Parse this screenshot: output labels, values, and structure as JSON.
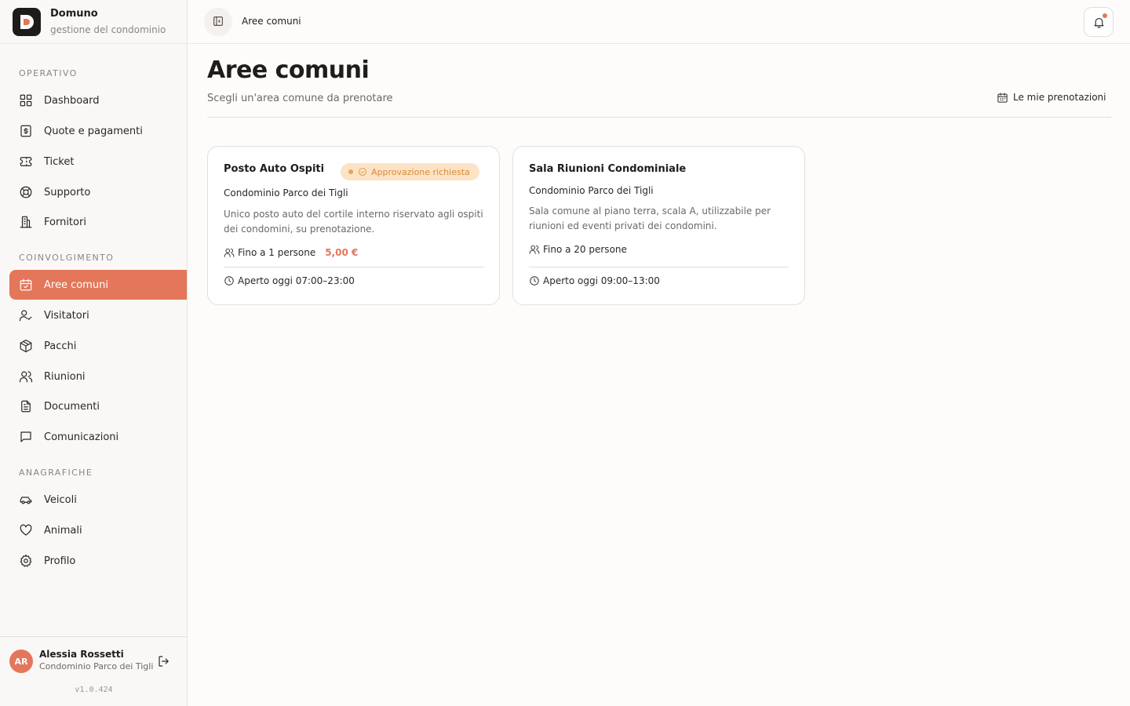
{
  "brand": {
    "name": "Domuno",
    "subtitle": "gestione del condominio"
  },
  "sidebar": {
    "sections": [
      {
        "label": "OPERATIVO"
      },
      {
        "label": "COINVOLGIMENTO"
      },
      {
        "label": "ANAGRAFICHE"
      }
    ],
    "items": [
      {
        "label": "Dashboard",
        "icon": "grid-icon"
      },
      {
        "label": "Quote e pagamenti",
        "icon": "receipt-icon"
      },
      {
        "label": "Ticket",
        "icon": "ticket-icon"
      },
      {
        "label": "Supporto",
        "icon": "lifebuoy-icon"
      },
      {
        "label": "Fornitori",
        "icon": "building-icon"
      },
      {
        "label": "Aree comuni",
        "icon": "calendar-check-icon",
        "active": true
      },
      {
        "label": "Visitatori",
        "icon": "user-check-icon"
      },
      {
        "label": "Pacchi",
        "icon": "package-icon"
      },
      {
        "label": "Riunioni",
        "icon": "users-icon"
      },
      {
        "label": "Documenti",
        "icon": "document-icon"
      },
      {
        "label": "Comunicazioni",
        "icon": "message-icon"
      },
      {
        "label": "Veicoli",
        "icon": "car-icon"
      },
      {
        "label": "Animali",
        "icon": "heart-icon"
      },
      {
        "label": "Profilo",
        "icon": "gear-icon"
      }
    ]
  },
  "user": {
    "initials": "AR",
    "name": "Alessia Rossetti",
    "condominium": "Condominio Parco dei Tigli",
    "version": "v1.0.424"
  },
  "topbar": {
    "breadcrumb": "Aree comuni"
  },
  "page": {
    "title": "Aree comuni",
    "subtitle": "Scegli un'area comune da prenotare",
    "my_bookings": "Le mie prenotazioni"
  },
  "colors": {
    "accent": "#e4765a",
    "badge_bg": "#fde3c5",
    "badge_text": "#d88a38"
  },
  "cards": [
    {
      "title": "Posto Auto Ospiti",
      "badge": "Approvazione richiesta",
      "condominium": "Condominio Parco dei Tigli",
      "description": "Unico posto auto del cortile interno riservato agli ospiti dei condomini, su prenotazione.",
      "capacity": "Fino a 1 persone",
      "price": "5,00 €",
      "hours": "Aperto oggi 07:00–23:00"
    },
    {
      "title": "Sala Riunioni Condominiale",
      "condominium": "Condominio Parco dei Tigli",
      "description": "Sala comune al piano terra, scala A, utilizzabile per riunioni ed eventi privati dei condomini.",
      "capacity": "Fino a 20 persone",
      "hours": "Aperto oggi 09:00–13:00"
    }
  ]
}
